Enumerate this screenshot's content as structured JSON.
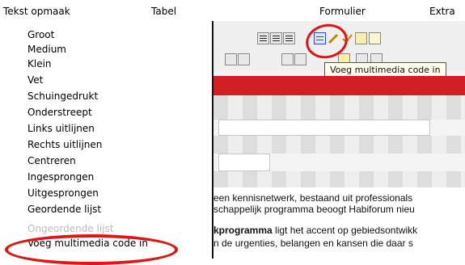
{
  "menubar": {
    "items": [
      "Tekst opmaak",
      "Tabel",
      "Formulier",
      "Extra"
    ]
  },
  "dropdown": {
    "items": [
      {
        "label": "Groot"
      },
      {
        "label": "Medium"
      },
      {
        "label": "Klein"
      },
      {
        "label": "Vet"
      },
      {
        "label": "Schuingedrukt"
      },
      {
        "label": "Onderstreept"
      },
      {
        "label": "Links uitlijnen"
      },
      {
        "label": "Rechts uitlijnen"
      },
      {
        "label": "Centreren"
      },
      {
        "label": "Ingesprongen"
      },
      {
        "label": "Uitgesprongen"
      },
      {
        "label": "Geordende lijst"
      },
      {
        "label": "Ongeordende lijst",
        "disabled": true
      },
      {
        "label": "Voeg multimedia code in"
      }
    ]
  },
  "tooltip": {
    "text": "Voeg multimedia code in"
  },
  "content": {
    "line1": "een kennisnetwerk, bestaand uit professionals",
    "line2": "schappelijk programma beoogt Habiforum nieu",
    "line3_bold": "kprogramma",
    "line3_rest": " ligt het accent op gebiedsontwikk",
    "line4": "n de urgenties, belangen en kansen die daar s"
  },
  "colors": {
    "accent_red": "#d31e26",
    "highlight_red": "#e01515"
  }
}
